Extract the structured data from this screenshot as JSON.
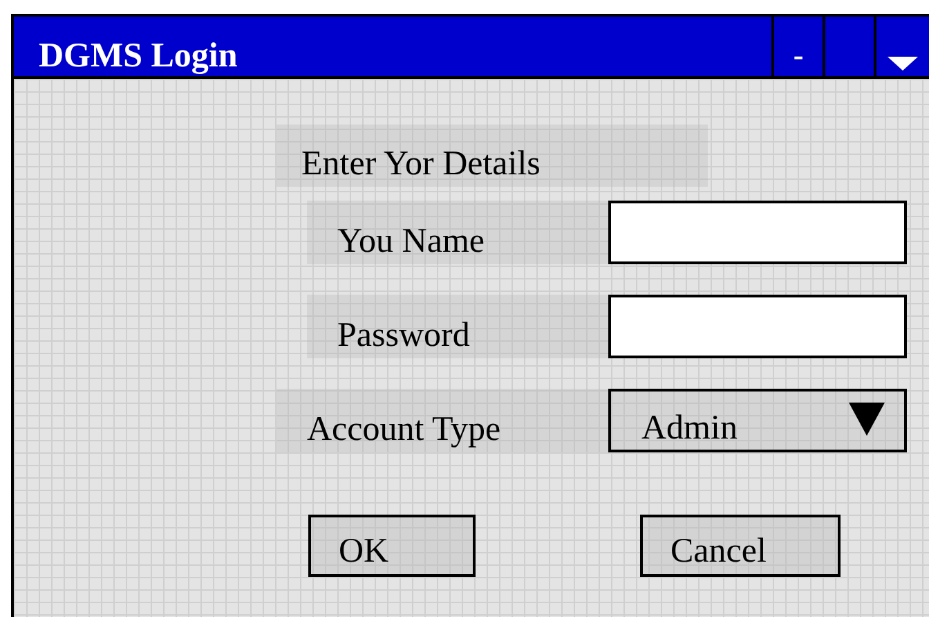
{
  "window": {
    "title": "DGMS Login",
    "minimize": "-"
  },
  "heading": "Enter Yor Details",
  "fields": [
    {
      "kind": "text",
      "label": "You Name"
    },
    {
      "kind": "password",
      "label": "Password"
    },
    {
      "kind": "select",
      "label": "Account Type",
      "value": "Admin"
    }
  ],
  "buttons": [
    "OK",
    "Cancel"
  ]
}
